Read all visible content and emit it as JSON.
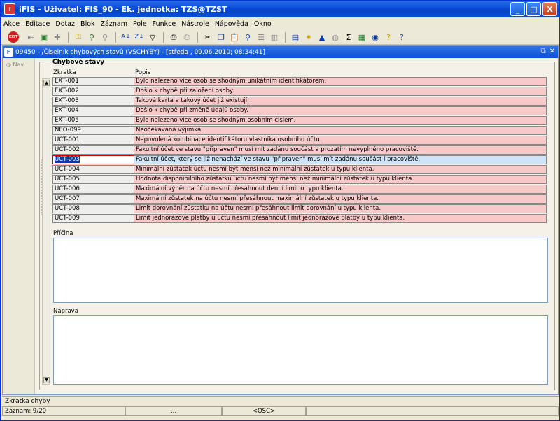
{
  "window": {
    "title": "iFIS - Uživatel: FIS_90 - Ek. jednotka: TZS@TZST",
    "min": "_",
    "max": "□",
    "close": "X"
  },
  "menu": {
    "items": [
      "Akce",
      "Editace",
      "Dotaz",
      "Blok",
      "Záznam",
      "Pole",
      "Funkce",
      "Nástroje",
      "Nápověda",
      "Okno"
    ]
  },
  "toolbar": {
    "exit_label": "EXIT"
  },
  "form": {
    "title": "09450 - /Číselník chybových stavů (VSCHYBY) - [středa , 09.06.2010; 08:34:41]",
    "icon_letter": "F",
    "restore": "⧉",
    "close": "✕",
    "nav_label": "Nav",
    "frame_title": "Chybové stavy",
    "col_code": "Zkratka",
    "col_desc": "Popis",
    "cause_label": "Příčina",
    "remedy_label": "Náprava"
  },
  "rows": [
    {
      "code": "EXT-001",
      "desc": "Bylo nalezeno více osob se shodným unikátním identifikátorem.",
      "selected": false
    },
    {
      "code": "EXT-002",
      "desc": "Došlo k chybě při založení osoby.",
      "selected": false
    },
    {
      "code": "EXT-003",
      "desc": "Taková karta a takový účet již existují.",
      "selected": false
    },
    {
      "code": "EXT-004",
      "desc": "Došlo k chybě při změně údajů osoby.",
      "selected": false
    },
    {
      "code": "EXT-005",
      "desc": "Bylo nalezeno více osob se shodným osobním číslem.",
      "selected": false
    },
    {
      "code": "NEO-099",
      "desc": "Neočekávaná výjimka.",
      "selected": false
    },
    {
      "code": "UCT-001",
      "desc": "Nepovolená kombinace identifikátoru vlastníka osobního účtu.",
      "selected": false
    },
    {
      "code": "UCT-002",
      "desc": "Fakultní účet ve stavu \"připraven\" musí mít zadánu součást a prozatím nevyplněno pracoviště.",
      "selected": false
    },
    {
      "code": "UCT-003",
      "desc": "Fakultní účet, který se již nenachází ve stavu \"připraven\" musí mít zadánu součást i pracoviště.",
      "selected": true
    },
    {
      "code": "UCT-004",
      "desc": "Minimální zůstatek účtu nesmí být menší než minimální zůstatek u typu klienta.",
      "selected": false
    },
    {
      "code": "UCT-005",
      "desc": "Hodnota disponibilního zůstatku účtu nesmí být menší než minimální zůstatek u typu klienta.",
      "selected": false
    },
    {
      "code": "UCT-006",
      "desc": "Maximální výběr na účtu nesmí přesáhnout denní limit u typu klienta.",
      "selected": false
    },
    {
      "code": "UCT-007",
      "desc": "Maximální zůstatek na účtu nesmí přesáhnout maximální zůstatek u typu klienta.",
      "selected": false
    },
    {
      "code": "UCT-008",
      "desc": "Limit dorovnání zůstatku na účtu nesmí přesáhnout limit dorovnání u typu klienta.",
      "selected": false
    },
    {
      "code": "UCT-009",
      "desc": "Limit jednorázové platby u účtu nesmí přesáhnout limit jednorázové platby u typu klienta.",
      "selected": false
    }
  ],
  "status": {
    "hint": "Zkratka chyby",
    "record": "Záznam: 9/20",
    "more": "...",
    "osc": "<OSC>"
  }
}
